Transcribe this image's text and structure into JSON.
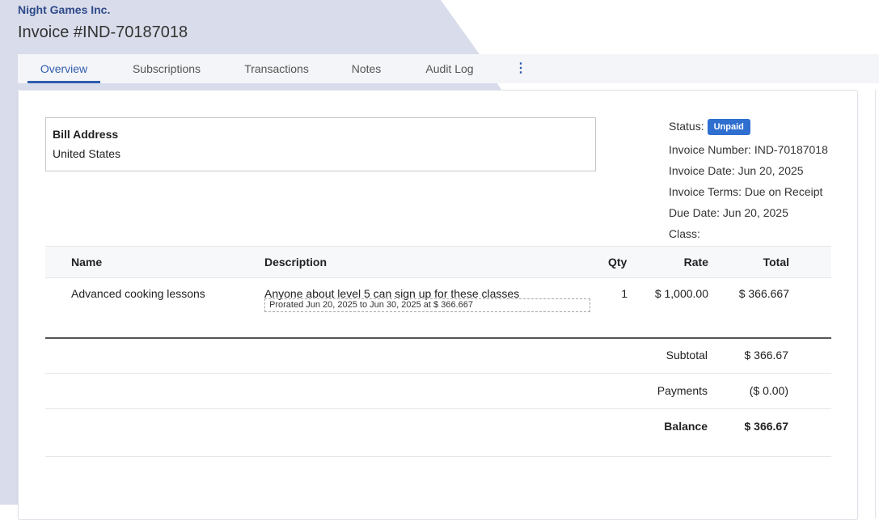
{
  "header": {
    "company": "Night Games Inc.",
    "title": "Invoice #IND-70187018"
  },
  "tabs": [
    {
      "label": "Overview",
      "active": true
    },
    {
      "label": "Subscriptions",
      "active": false
    },
    {
      "label": "Transactions",
      "active": false
    },
    {
      "label": "Notes",
      "active": false
    },
    {
      "label": "Audit Log",
      "active": false
    }
  ],
  "more_icon": "kebab-vertical-icon",
  "bill": {
    "title": "Bill Address",
    "country": "United States"
  },
  "meta": {
    "status_label": "Status:",
    "status_badge": "Unpaid",
    "invoice_number": "Invoice Number: IND-70187018",
    "invoice_date": "Invoice Date: Jun 20, 2025",
    "invoice_terms": "Invoice Terms: Due on Receipt",
    "due_date": "Due Date: Jun 20, 2025",
    "class": "Class:"
  },
  "table": {
    "headers": {
      "name": "Name",
      "description": "Description",
      "qty": "Qty",
      "rate": "Rate",
      "total": "Total"
    },
    "rows": [
      {
        "name": "Advanced cooking lessons",
        "description": "Anyone about level 5 can sign up for these classes",
        "note": "Prorated Jun 20, 2025 to Jun 30, 2025 at $ 366.667",
        "qty": "1",
        "rate": "$ 1,000.00",
        "total": "$ 366.667"
      }
    ]
  },
  "summary": {
    "subtotal_label": "Subtotal",
    "subtotal_value": "$ 366.67",
    "payments_label": "Payments",
    "payments_value": "($ 0.00)",
    "balance_label": "Balance",
    "balance_value": "$ 366.67"
  },
  "colors": {
    "accent": "#2f5cad",
    "badge": "#2f6fd0",
    "background_shape": "#d7dbe9"
  }
}
